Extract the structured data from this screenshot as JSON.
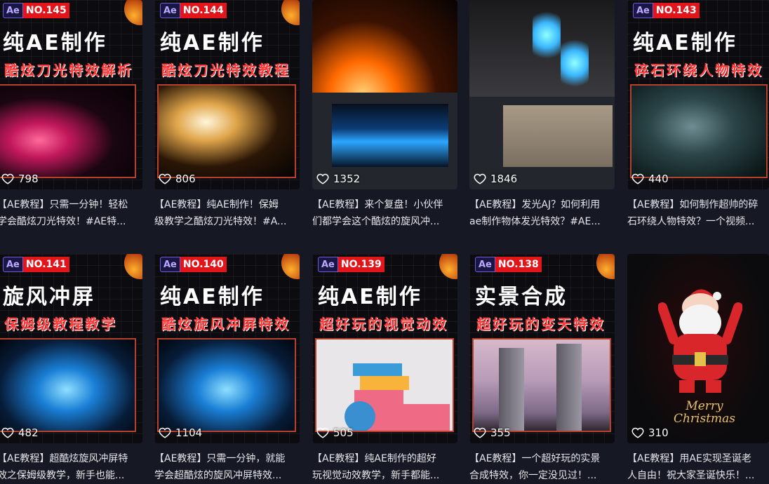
{
  "cards": [
    {
      "no": "NO.145",
      "ae": "Ae",
      "h1": "纯AE制作",
      "h2": "酷炫刀光特效解析",
      "likes": "798",
      "title": "【AE教程】只需一分钟！轻松\n学会酷炫刀光特效！#AE特..."
    },
    {
      "no": "NO.144",
      "ae": "Ae",
      "h1": "纯AE制作",
      "h2": "酷炫刀光特效教程",
      "likes": "806",
      "title": "【AE教程】纯AE制作！保姆\n级教学之酷炫刀光特效！#A..."
    },
    {
      "likes": "1352",
      "title": "【AE教程】来个复盘！小伙伴\n们都学会这个酷炫的旋风冲..."
    },
    {
      "likes": "1846",
      "title": "【AE教程】发光AJ？如何利用\nae制作物体发光特效？#AE..."
    },
    {
      "no": "NO.143",
      "ae": "Ae",
      "h1": "纯AE制作",
      "h2": "碎石环绕人物特效",
      "likes": "440",
      "title": "【AE教程】如何制作超帅的碎\n石环绕人物特效？一个视频..."
    },
    {
      "no": "NO.141",
      "ae": "Ae",
      "h1": "旋风冲屏",
      "h2": "保姆级教程教学",
      "likes": "482",
      "title": "【AE教程】超酷炫旋风冲屏特\n效之保姆级教学，新手也能..."
    },
    {
      "no": "NO.140",
      "ae": "Ae",
      "h1": "纯AE制作",
      "h2": "酷炫旋风冲屏特效",
      "likes": "1104",
      "title": "【AE教程】只需一分钟，就能\n学会超酷炫的旋风冲屏特效..."
    },
    {
      "no": "NO.139",
      "ae": "Ae",
      "h1": "纯AE制作",
      "h2": "超好玩的视觉动效",
      "likes": "505",
      "title": "【AE教程】纯AE制作的超好\n玩视觉动效教学，新手都能..."
    },
    {
      "no": "NO.138",
      "ae": "Ae",
      "h1": "实景合成",
      "h2": "超好玩的变天特效",
      "likes": "355",
      "title": "【AE教程】一个超好玩的实景\n合成特效，你一定没见过！..."
    },
    {
      "likes": "310",
      "title": "【AE教程】用AE实现圣诞老\n人自由！祝大家圣诞快乐！...",
      "overlay": "Merry Christmas"
    }
  ]
}
